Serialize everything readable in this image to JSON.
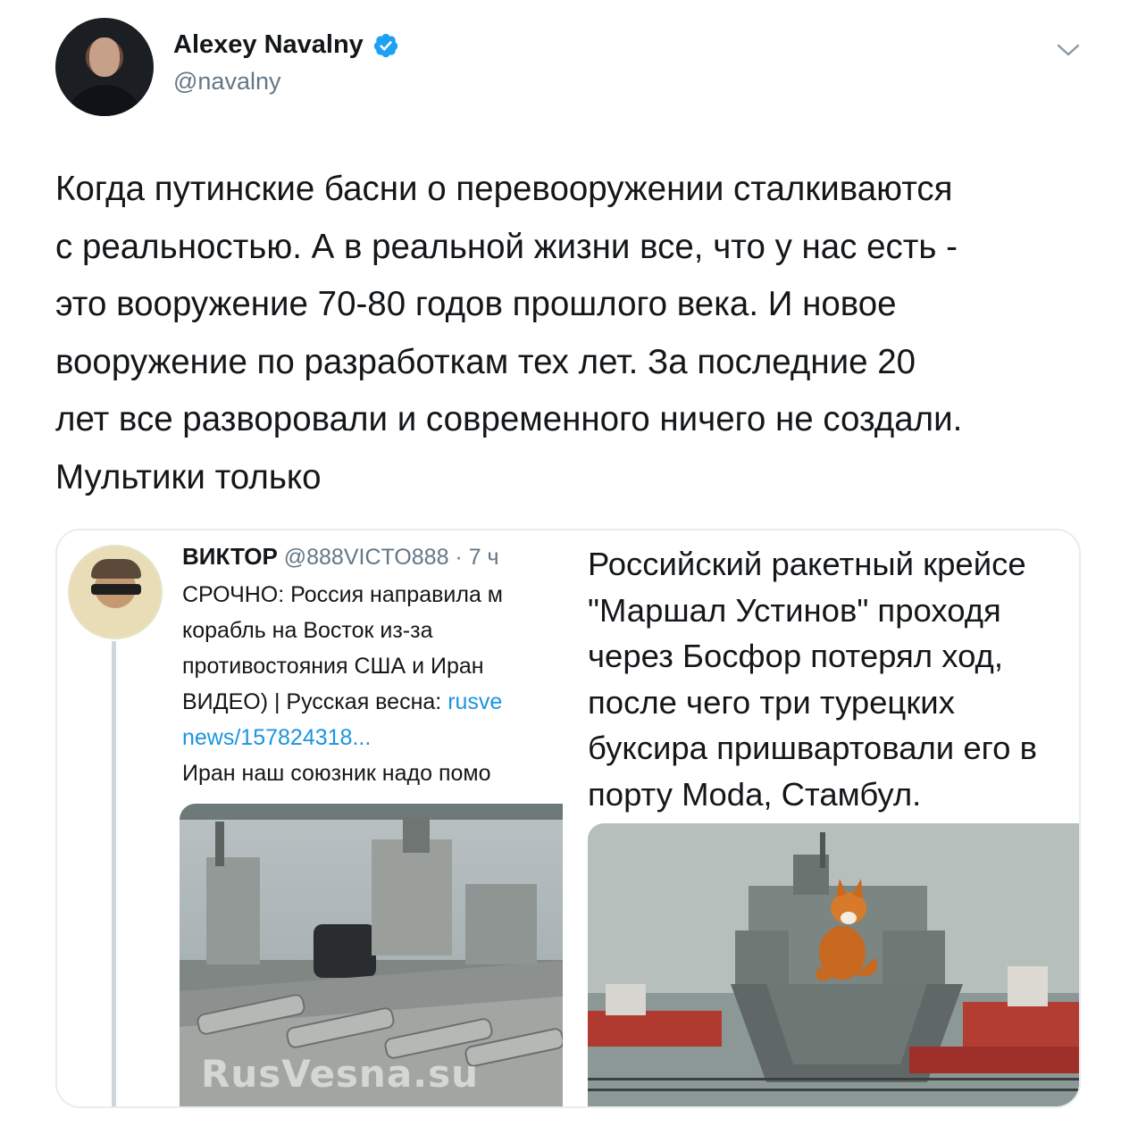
{
  "author": {
    "display_name": "Alexey Navalny",
    "handle": "@navalny",
    "verified": true,
    "icons": [
      "verified-badge-icon",
      "chevron-down-icon"
    ]
  },
  "tweet": {
    "lines": [
      "Когда путинские басни о перевооружении сталкиваются",
      "с реальностью. А в реальной жизни все, что у нас есть -",
      "это вооружение 70-80 годов прошлого века. И новое",
      "вооружение по разработкам тех лет. За последние 20",
      "лет все разворовали и современного ничего не создали.",
      "Мультики только"
    ]
  },
  "media": {
    "left": {
      "name": "ВИКТОР",
      "handle": "@888VICTO888",
      "sep": " · ",
      "time": "7 ч",
      "body_lines": [
        "СРОЧНО: Россия направила м",
        "корабль на Восток из-за",
        "противостояния США и Иран",
        "ВИДЕО) | Русская весна: "
      ],
      "link_part1": "rusve",
      "link_part2": "news/157824318...",
      "last_line": "Иран наш союзник надо помо",
      "watermark": "RusVesna.su"
    },
    "right": {
      "lines": [
        "Российский ракетный крейсе",
        "\"Маршал Устинов\" проходя",
        "через Босфор потерял ход,",
        "после чего три турецких",
        "буксира пришвартовали его в",
        "порту Moda, Стамбул."
      ]
    }
  },
  "colors": {
    "text": "#14171a",
    "secondary": "#657786",
    "link": "#1b95e0",
    "verified": "#1da1f2",
    "border": "#e6ecf0"
  }
}
